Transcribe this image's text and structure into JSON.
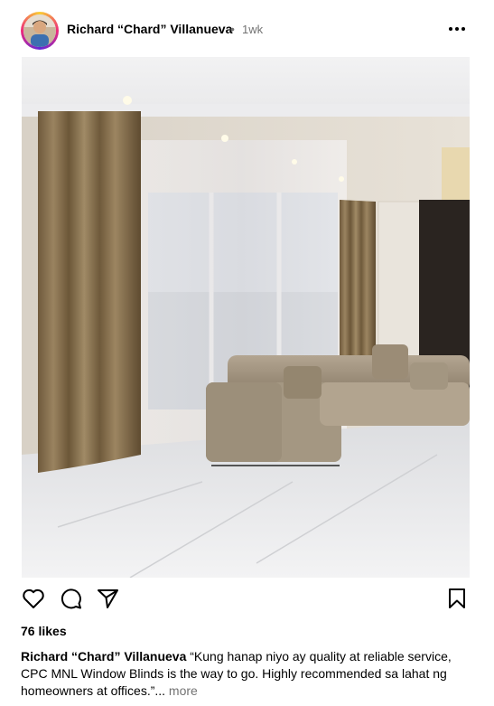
{
  "header": {
    "username": "Richard “Chard” Villanueva",
    "separator": "•",
    "time": "1wk",
    "more_icon": "more-horizontal-icon"
  },
  "photo": {
    "subject": "living-room-curtains-photo"
  },
  "actions": {
    "icons": [
      "heart-icon",
      "comment-icon",
      "share-icon",
      "bookmark-icon"
    ]
  },
  "likes": "76 likes",
  "caption": {
    "username": "Richard “Chard” Villanueva",
    "line1": " “Kung hanap niyo ay quality at reliable service,",
    "line2": "CPC MNL Window Blinds is the way to go. Highly recommended sa lahat ng",
    "line3": "homeowners at offices.”",
    "ellipsis": "...",
    "more": " more"
  },
  "colors": {
    "text": "#000000",
    "muted": "#737373",
    "curtain": "#8a7452",
    "sofa": "#a89882"
  }
}
